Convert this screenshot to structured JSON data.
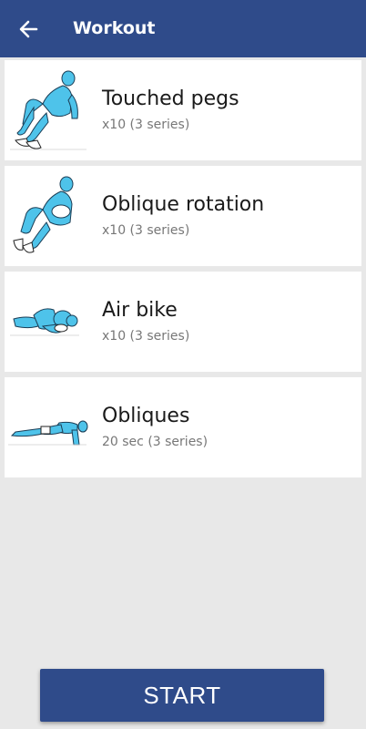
{
  "appbar": {
    "title": "Workout",
    "back_icon": "arrow-left-icon",
    "color": "#2f4b8a"
  },
  "exercises": [
    {
      "name": "Touched pegs",
      "reps": "x10 (3 series)",
      "icon": "touched-pegs-figure-icon"
    },
    {
      "name": "Oblique rotation",
      "reps": "x10 (3 series)",
      "icon": "oblique-rotation-figure-icon"
    },
    {
      "name": "Air bike",
      "reps": "x10 (3 series)",
      "icon": "air-bike-figure-icon"
    },
    {
      "name": "Obliques",
      "reps": "20 sec (3 series)",
      "icon": "obliques-figure-icon"
    }
  ],
  "start_button": {
    "label": "START",
    "color": "#2f4b8a"
  },
  "colors": {
    "background": "#e8e8e8",
    "figure_fill": "#4ec3ea"
  }
}
